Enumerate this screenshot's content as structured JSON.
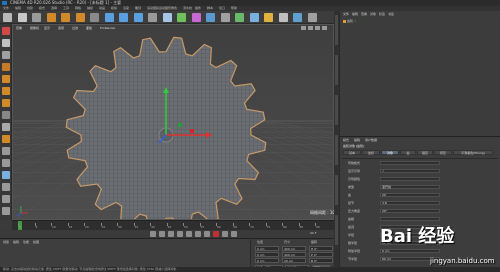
{
  "window": {
    "title": "CINEMA 4D R20.026 Studio (RC - R20) - [未标题 1] - 主要"
  },
  "menubar": {
    "items": [
      "文件",
      "编辑",
      "创建",
      "模式",
      "选择",
      "工具",
      "网格",
      "捕捉",
      "动画",
      "模拟",
      "渲染",
      "雕刻",
      "运动跟踪",
      "运动图形",
      "角色",
      "流水线",
      "插件",
      "脚本",
      "窗口",
      "帮助"
    ]
  },
  "viewport": {
    "menu": [
      "查看",
      "摄像机",
      "显示",
      "选项",
      "过滤",
      "面板",
      "ProRender"
    ],
    "label": "透视视图",
    "grid_label": "网格间距 : 100 cm"
  },
  "timeline": {
    "ticks": [
      "0",
      "5",
      "10",
      "15",
      "20",
      "25",
      "30",
      "35",
      "40",
      "45",
      "50",
      "55",
      "60",
      "65",
      "70",
      "75",
      "80",
      "85",
      "90"
    ],
    "end_frame": "90 F"
  },
  "material_panel": {
    "menu": [
      "创建",
      "编辑",
      "功能",
      "纹理"
    ]
  },
  "coordinates": {
    "labels": [
      "位置",
      "尺寸",
      "旋转"
    ],
    "rows": [
      {
        "axis": "X",
        "pos": "0 cm",
        "size": "400 cm",
        "rot": "H 0°"
      },
      {
        "axis": "Y",
        "pos": "0 cm",
        "size": "400 cm",
        "rot": "P 0°"
      },
      {
        "axis": "Z",
        "pos": "0 cm",
        "size": "20 cm",
        "rot": "B 0°"
      }
    ],
    "mode": "对象 (相对)",
    "size_mode": "绝对尺寸",
    "apply": "应用"
  },
  "object_manager": {
    "menu": [
      "文件",
      "编辑",
      "查看",
      "对象",
      "标签",
      "书签"
    ],
    "objects": [
      {
        "name": "齿轮",
        "color": "#e0a030"
      }
    ]
  },
  "attributes": {
    "menu": [
      "模式",
      "编辑",
      "用户数据"
    ],
    "object_title": "齿轮对象 [齿轮]",
    "tabs": [
      "基本",
      "坐标",
      "对象",
      "齿",
      "锁定",
      "挤压",
      "平滑着色(Phong)"
    ],
    "active_tab": "对象",
    "properties": [
      {
        "label": "传统模式",
        "value": ""
      },
      {
        "label": "显示引导",
        "value": "✓"
      },
      {
        "label": "引导颜色",
        "value": ""
      },
      {
        "label": "类型",
        "value": "渐开线"
      },
      {
        "label": "齿",
        "value": "20"
      },
      {
        "label": "径节",
        "value": "3.8"
      },
      {
        "label": "压力角度",
        "value": "20°"
      },
      {
        "label": "齿根",
        "value": ""
      },
      {
        "label": "齿顶",
        "value": ""
      },
      {
        "label": "半径",
        "value": "100 cm"
      },
      {
        "label": "根半径",
        "value": "42 cm"
      },
      {
        "label": "附加半径",
        "value": "0 cm"
      },
      {
        "label": "节半径",
        "value": "60 cm"
      }
    ]
  },
  "status": {
    "text": "移动: 点击并拖动鼠标移动元素. 按住 SHIFT 键量化移动; 节点编辑模式时按住 SHIFT 键增加选择对象; 按住 CTRL 键减少选择对象."
  },
  "watermark": {
    "brand": "Bai 经验",
    "url": "jingyan.baidu.com"
  },
  "colors": {
    "accent": "#1d78c6",
    "gear": "#6b6e72",
    "gear_outline": "#caa070",
    "axis_y": "#2ecc40",
    "axis_x": "#e03030",
    "axis_z": "#3060e0"
  }
}
